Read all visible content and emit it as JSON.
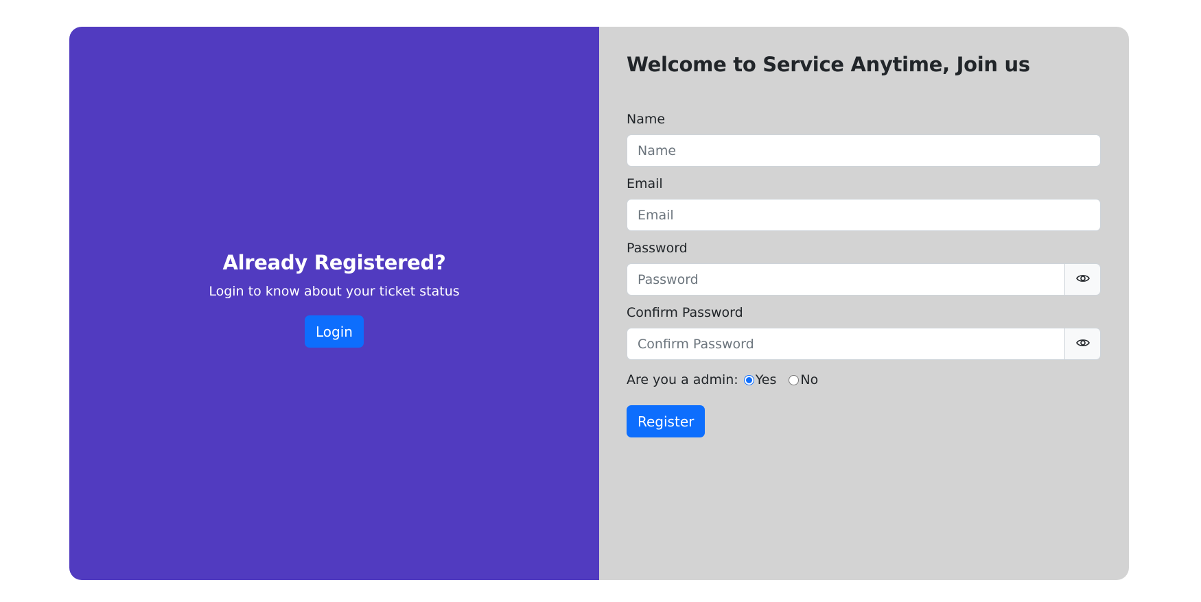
{
  "left": {
    "title": "Already Registered?",
    "text": "Login to know about your ticket status",
    "login_label": "Login"
  },
  "form": {
    "title": "Welcome to Service Anytime, Join us",
    "name": {
      "label": "Name",
      "placeholder": "Name",
      "value": ""
    },
    "email": {
      "label": "Email",
      "placeholder": "Email",
      "value": ""
    },
    "password": {
      "label": "Password",
      "placeholder": "Password",
      "value": ""
    },
    "confirm_password": {
      "label": "Confirm Password",
      "placeholder": "Confirm Password",
      "value": ""
    },
    "admin": {
      "label": "Are you a admin:",
      "options": [
        "Yes",
        "No"
      ],
      "selected": "Yes"
    },
    "register_label": "Register"
  },
  "icons": {
    "password_toggle": "eye-icon",
    "confirm_password_toggle": "eye-icon"
  },
  "colors": {
    "left_panel": "#513bc0",
    "right_panel": "#d3d3d3",
    "primary_button": "#0d6efd"
  }
}
